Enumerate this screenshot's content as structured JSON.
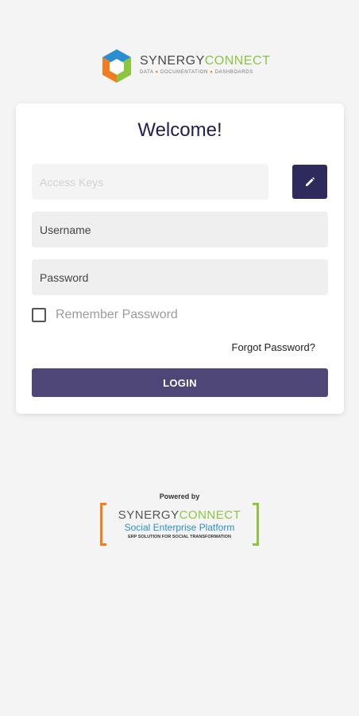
{
  "brand": {
    "part1": "SYNERGY",
    "part2": "CONNECT",
    "tagline": [
      "DATA",
      "DOCUMENTATION",
      "DASHBOARDS"
    ],
    "colors": {
      "orange": "#f47b20",
      "green": "#8cc63f",
      "blue": "#2a8fd1"
    }
  },
  "login": {
    "title": "Welcome!",
    "access_keys_placeholder": "Access Keys",
    "username_placeholder": "Username",
    "password_placeholder": "Password",
    "remember_label": "Remember Password",
    "remember_checked": false,
    "forgot_label": "Forgot Password?",
    "login_label": "LOGIN",
    "edit_icon": "pencil-icon",
    "accent_color": "#2f2a5c"
  },
  "footer": {
    "powered_by": "Powered by",
    "brand_part1": "SYNERGY",
    "brand_part2": "CONNECT",
    "subtitle": "Social Enterprise Platform",
    "tagline": "ERP SOLUTION FOR SOCIAL TRANSFORMATION"
  }
}
